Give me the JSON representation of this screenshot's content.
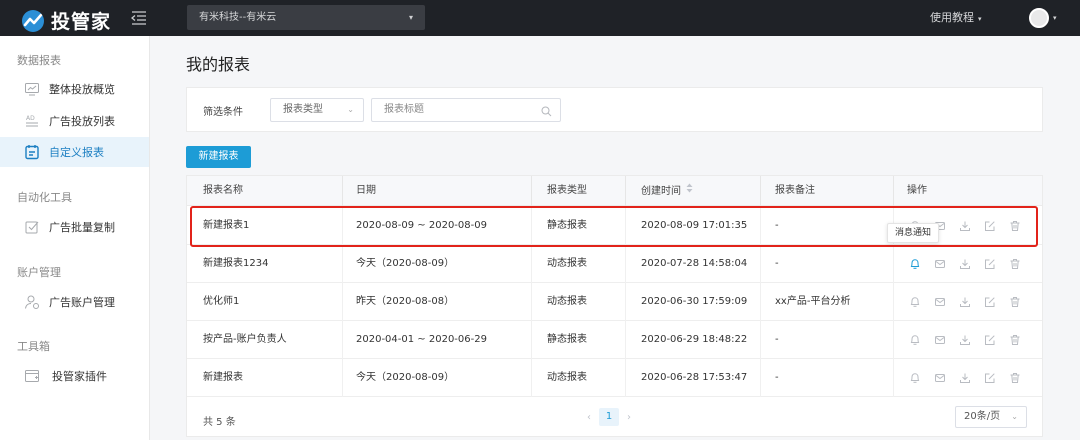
{
  "topbar": {
    "brand": "投管家",
    "account": "有米科技--有米云",
    "help": "使用教程",
    "caret": "▾"
  },
  "sidebar": {
    "groups": [
      {
        "label": "数据报表",
        "items": [
          {
            "label": "整体投放概览",
            "icon": "monitor-icon",
            "active": false
          },
          {
            "label": "广告投放列表",
            "icon": "ad-list-icon",
            "active": false
          },
          {
            "label": "自定义报表",
            "icon": "custom-report-icon",
            "active": true
          }
        ]
      },
      {
        "label": "自动化工具",
        "items": [
          {
            "label": "广告批量复制",
            "icon": "copy-check-icon",
            "active": false
          }
        ]
      },
      {
        "label": "账户管理",
        "items": [
          {
            "label": "广告账户管理",
            "icon": "user-manage-icon",
            "active": false
          }
        ]
      },
      {
        "label": "工具箱",
        "items": [
          {
            "label": "投管家插件",
            "icon": "plugin-icon",
            "active": false
          }
        ]
      }
    ]
  },
  "main": {
    "title": "我的报表",
    "filter": {
      "label": "筛选条件",
      "type_placeholder": "报表类型",
      "title_placeholder": "报表标题"
    },
    "new_button": "新建报表",
    "table": {
      "columns": [
        "报表名称",
        "日期",
        "报表类型",
        "创建时间",
        "报表备注",
        "操作"
      ],
      "rows": [
        {
          "name": "新建报表1",
          "date": "2020-08-09 ~ 2020-08-09",
          "type": "静态报表",
          "created": "2020-08-09 17:01:35",
          "note": "-"
        },
        {
          "name": "新建报表1234",
          "date": "今天（2020-08-09）",
          "type": "动态报表",
          "created": "2020-07-28 14:58:04",
          "note": "-"
        },
        {
          "name": "优化师1",
          "date": "昨天（2020-08-08）",
          "type": "动态报表",
          "created": "2020-06-30 17:59:09",
          "note": "xx产品-平台分析"
        },
        {
          "name": "按产品-账户负责人",
          "date": "2020-04-01 ~ 2020-06-29",
          "type": "静态报表",
          "created": "2020-06-29 18:48:22",
          "note": "-"
        },
        {
          "name": "新建报表",
          "date": "今天（2020-08-09）",
          "type": "动态报表",
          "created": "2020-06-28 17:53:47",
          "note": "-"
        }
      ],
      "tooltip": "消息通知",
      "accent_color": "#1d9cd6",
      "highlight_color": "#e2231a"
    },
    "footer": {
      "total": "共 5 条",
      "current_page": "1",
      "page_size": "20条/页"
    }
  }
}
